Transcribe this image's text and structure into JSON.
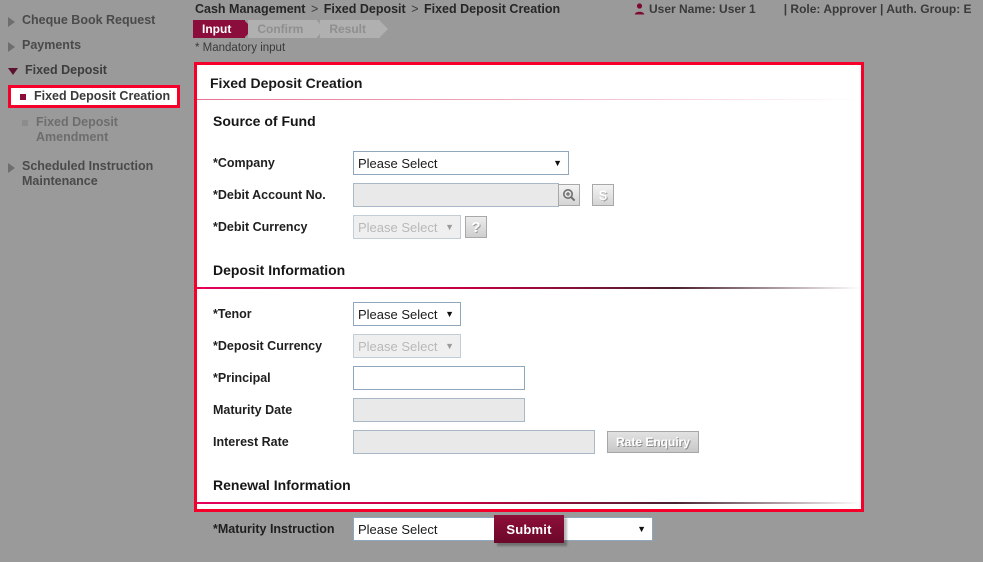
{
  "sidebar": {
    "groups": [
      {
        "label": "Cheque Book Request",
        "expanded": false,
        "items": []
      },
      {
        "label": "Payments",
        "expanded": false,
        "items": []
      },
      {
        "label": "Fixed Deposit",
        "expanded": true,
        "items": [
          {
            "label": "Fixed Deposit Creation",
            "active": true
          },
          {
            "label": "Fixed Deposit Amendment",
            "active": false
          }
        ]
      },
      {
        "label": "Scheduled Instruction Maintenance",
        "expanded": false,
        "items": []
      }
    ]
  },
  "header": {
    "breadcrumb": [
      "Cash Management",
      "Fixed Deposit",
      "Fixed Deposit Creation"
    ],
    "breadcrumb_separator": ">",
    "user_icon": "user-icon",
    "user_name": "User Name: User 1",
    "role_info": "| Role: Approver | Auth. Group: E",
    "steps": [
      {
        "label": "Input",
        "state": "active"
      },
      {
        "label": "Confirm",
        "state": "inactive"
      },
      {
        "label": "Result",
        "state": "inactive"
      }
    ],
    "mandatory_note": "* Mandatory input"
  },
  "panel": {
    "title": "Fixed Deposit Creation",
    "sections": [
      {
        "heading": "Source of Fund",
        "rows": [
          {
            "label": "*Company",
            "control": "select",
            "value": "Please Select",
            "disabled": false,
            "width": "w-company"
          },
          {
            "label": "*Debit Account No.",
            "control": "input-icons",
            "value": "",
            "disabled": true,
            "width": "w-acct",
            "icons": [
              {
                "name": "search-plus-icon",
                "glyph": "zoom"
              },
              {
                "name": "currency-dollar-icon",
                "glyph": "$"
              }
            ]
          },
          {
            "label": "*Debit Currency",
            "control": "select-help",
            "value": "Please Select",
            "disabled": true,
            "width": "w-small",
            "help_glyph": "?"
          }
        ]
      },
      {
        "heading": "Deposit Information",
        "rows": [
          {
            "label": "*Tenor",
            "control": "select",
            "value": "Please Select",
            "disabled": false,
            "width": "w-small"
          },
          {
            "label": "*Deposit Currency",
            "control": "select",
            "value": "Please Select",
            "disabled": true,
            "width": "w-small"
          },
          {
            "label": "*Principal",
            "control": "input",
            "value": "",
            "disabled": false,
            "width": "w-principal"
          },
          {
            "label": "Maturity Date",
            "control": "input",
            "value": "",
            "disabled": true,
            "width": "w-maturity",
            "muted": false
          },
          {
            "label": "Interest Rate",
            "control": "input-button",
            "value": "",
            "disabled": true,
            "width": "w-rate",
            "button_label": "Rate Enquiry"
          }
        ]
      },
      {
        "heading": "Renewal Information",
        "rows": [
          {
            "label": "*Maturity Instruction",
            "control": "select",
            "value": "Please Select",
            "disabled": false,
            "width": "w-wide"
          }
        ]
      }
    ]
  },
  "footer": {
    "submit_label": "Submit"
  },
  "colors": {
    "accent_maroon": "#8b0d3b",
    "annotation_red": "#f4002b",
    "page_gray": "#9a9a9a",
    "divider_crimson": "#e5005a"
  }
}
